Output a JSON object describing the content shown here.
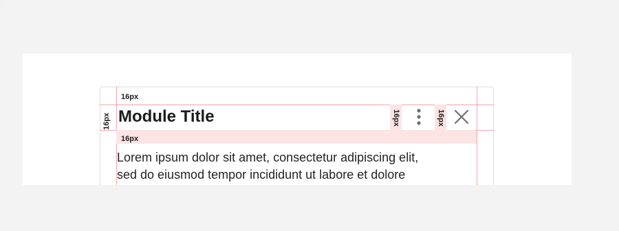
{
  "module": {
    "title": "Module Title",
    "body_lines": [
      "Lorem ipsum dolor sit amet, consectetur adipiscing elit,",
      "sed do eiusmod tempor incididunt ut labore et dolore"
    ],
    "icons": {
      "menu": "more-vertical-icon",
      "close": "close-icon"
    }
  },
  "annotations": {
    "top_padding": "16px",
    "left_padding": "16px",
    "title_gap": "16px",
    "menu_gap": "16px",
    "close_gap": "16px"
  },
  "colors": {
    "guide": "#eb5f69",
    "spacing_fill": "#fce3e4",
    "card_border": "#dedede",
    "icon": "#6f6f6f"
  }
}
